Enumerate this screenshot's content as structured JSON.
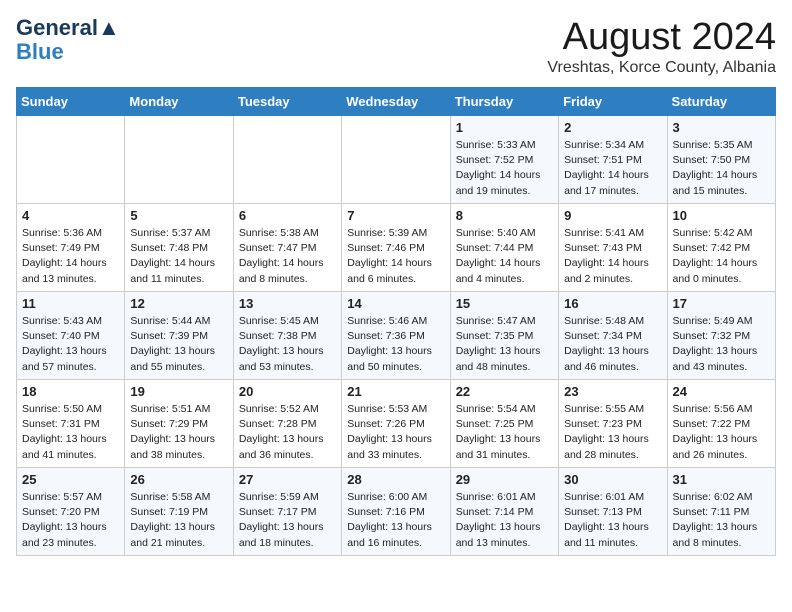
{
  "logo": {
    "line1": "General",
    "line2": "Blue"
  },
  "title": "August 2024",
  "subtitle": "Vreshtas, Korce County, Albania",
  "days_of_week": [
    "Sunday",
    "Monday",
    "Tuesday",
    "Wednesday",
    "Thursday",
    "Friday",
    "Saturday"
  ],
  "weeks": [
    [
      {
        "day": "",
        "info": ""
      },
      {
        "day": "",
        "info": ""
      },
      {
        "day": "",
        "info": ""
      },
      {
        "day": "",
        "info": ""
      },
      {
        "day": "1",
        "info": "Sunrise: 5:33 AM\nSunset: 7:52 PM\nDaylight: 14 hours\nand 19 minutes."
      },
      {
        "day": "2",
        "info": "Sunrise: 5:34 AM\nSunset: 7:51 PM\nDaylight: 14 hours\nand 17 minutes."
      },
      {
        "day": "3",
        "info": "Sunrise: 5:35 AM\nSunset: 7:50 PM\nDaylight: 14 hours\nand 15 minutes."
      }
    ],
    [
      {
        "day": "4",
        "info": "Sunrise: 5:36 AM\nSunset: 7:49 PM\nDaylight: 14 hours\nand 13 minutes."
      },
      {
        "day": "5",
        "info": "Sunrise: 5:37 AM\nSunset: 7:48 PM\nDaylight: 14 hours\nand 11 minutes."
      },
      {
        "day": "6",
        "info": "Sunrise: 5:38 AM\nSunset: 7:47 PM\nDaylight: 14 hours\nand 8 minutes."
      },
      {
        "day": "7",
        "info": "Sunrise: 5:39 AM\nSunset: 7:46 PM\nDaylight: 14 hours\nand 6 minutes."
      },
      {
        "day": "8",
        "info": "Sunrise: 5:40 AM\nSunset: 7:44 PM\nDaylight: 14 hours\nand 4 minutes."
      },
      {
        "day": "9",
        "info": "Sunrise: 5:41 AM\nSunset: 7:43 PM\nDaylight: 14 hours\nand 2 minutes."
      },
      {
        "day": "10",
        "info": "Sunrise: 5:42 AM\nSunset: 7:42 PM\nDaylight: 14 hours\nand 0 minutes."
      }
    ],
    [
      {
        "day": "11",
        "info": "Sunrise: 5:43 AM\nSunset: 7:40 PM\nDaylight: 13 hours\nand 57 minutes."
      },
      {
        "day": "12",
        "info": "Sunrise: 5:44 AM\nSunset: 7:39 PM\nDaylight: 13 hours\nand 55 minutes."
      },
      {
        "day": "13",
        "info": "Sunrise: 5:45 AM\nSunset: 7:38 PM\nDaylight: 13 hours\nand 53 minutes."
      },
      {
        "day": "14",
        "info": "Sunrise: 5:46 AM\nSunset: 7:36 PM\nDaylight: 13 hours\nand 50 minutes."
      },
      {
        "day": "15",
        "info": "Sunrise: 5:47 AM\nSunset: 7:35 PM\nDaylight: 13 hours\nand 48 minutes."
      },
      {
        "day": "16",
        "info": "Sunrise: 5:48 AM\nSunset: 7:34 PM\nDaylight: 13 hours\nand 46 minutes."
      },
      {
        "day": "17",
        "info": "Sunrise: 5:49 AM\nSunset: 7:32 PM\nDaylight: 13 hours\nand 43 minutes."
      }
    ],
    [
      {
        "day": "18",
        "info": "Sunrise: 5:50 AM\nSunset: 7:31 PM\nDaylight: 13 hours\nand 41 minutes."
      },
      {
        "day": "19",
        "info": "Sunrise: 5:51 AM\nSunset: 7:29 PM\nDaylight: 13 hours\nand 38 minutes."
      },
      {
        "day": "20",
        "info": "Sunrise: 5:52 AM\nSunset: 7:28 PM\nDaylight: 13 hours\nand 36 minutes."
      },
      {
        "day": "21",
        "info": "Sunrise: 5:53 AM\nSunset: 7:26 PM\nDaylight: 13 hours\nand 33 minutes."
      },
      {
        "day": "22",
        "info": "Sunrise: 5:54 AM\nSunset: 7:25 PM\nDaylight: 13 hours\nand 31 minutes."
      },
      {
        "day": "23",
        "info": "Sunrise: 5:55 AM\nSunset: 7:23 PM\nDaylight: 13 hours\nand 28 minutes."
      },
      {
        "day": "24",
        "info": "Sunrise: 5:56 AM\nSunset: 7:22 PM\nDaylight: 13 hours\nand 26 minutes."
      }
    ],
    [
      {
        "day": "25",
        "info": "Sunrise: 5:57 AM\nSunset: 7:20 PM\nDaylight: 13 hours\nand 23 minutes."
      },
      {
        "day": "26",
        "info": "Sunrise: 5:58 AM\nSunset: 7:19 PM\nDaylight: 13 hours\nand 21 minutes."
      },
      {
        "day": "27",
        "info": "Sunrise: 5:59 AM\nSunset: 7:17 PM\nDaylight: 13 hours\nand 18 minutes."
      },
      {
        "day": "28",
        "info": "Sunrise: 6:00 AM\nSunset: 7:16 PM\nDaylight: 13 hours\nand 16 minutes."
      },
      {
        "day": "29",
        "info": "Sunrise: 6:01 AM\nSunset: 7:14 PM\nDaylight: 13 hours\nand 13 minutes."
      },
      {
        "day": "30",
        "info": "Sunrise: 6:01 AM\nSunset: 7:13 PM\nDaylight: 13 hours\nand 11 minutes."
      },
      {
        "day": "31",
        "info": "Sunrise: 6:02 AM\nSunset: 7:11 PM\nDaylight: 13 hours\nand 8 minutes."
      }
    ]
  ]
}
